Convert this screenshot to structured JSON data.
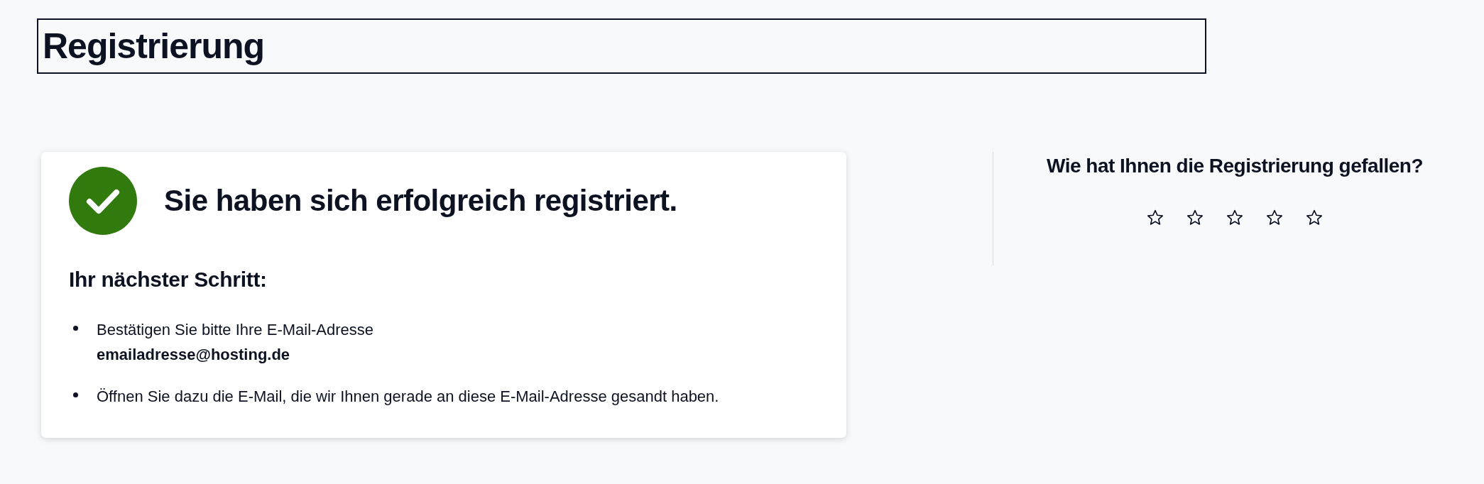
{
  "page_title": "Registrierung",
  "success_card": {
    "kind": "success",
    "message": "Sie haben sich erfolgreich registriert.",
    "next_step_heading": "Ihr nächster Schritt:",
    "steps": [
      "Bestätigen Sie bitte Ihre E-Mail-Adresse\n**emailadresse@hosting.de**",
      "Öffnen Sie dazu die E-Mail, die wir Ihnen gerade an diese E-Mail-Adresse gesandt haben."
    ]
  },
  "rating": {
    "question": "Wie hat Ihnen die Registrierung gefallen?",
    "stars": 0
  }
}
